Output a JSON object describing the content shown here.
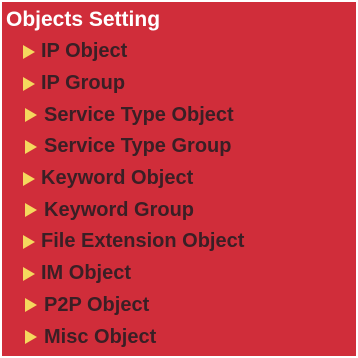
{
  "section": {
    "title": "Objects Setting"
  },
  "menu": {
    "bullet_icon": "arrow-right-icon",
    "items": [
      {
        "label": "IP Object"
      },
      {
        "label": "IP Group"
      },
      {
        "label": "Service Type Object"
      },
      {
        "label": "Service Type Group"
      },
      {
        "label": "Keyword Object"
      },
      {
        "label": "Keyword Group"
      },
      {
        "label": "File Extension Object"
      },
      {
        "label": "IM Object"
      },
      {
        "label": "P2P Object"
      },
      {
        "label": "Misc Object"
      }
    ]
  },
  "colors": {
    "background": "#d02d3a",
    "title_text": "#ffffff",
    "item_text": "#3a1f25",
    "bullet": "#f5d85e"
  }
}
